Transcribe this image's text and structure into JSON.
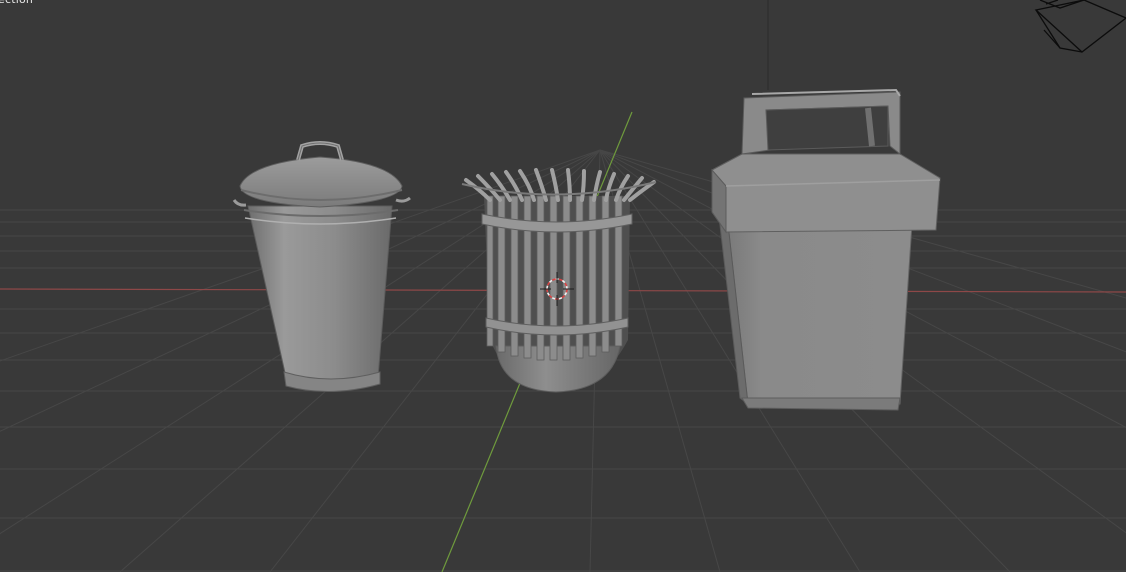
{
  "viewport": {
    "collection_label": "ection",
    "background_color": "#393939",
    "grid_color": "#4a4a4a",
    "x_axis_color": "#9a4c4c",
    "y_axis_color": "#6d9a3c"
  },
  "objects": [
    {
      "name": "metal-trash-can-with-lid",
      "color": "#8a8a8a"
    },
    {
      "name": "slatted-basket-trash-bin",
      "color": "#8a8a8a"
    },
    {
      "name": "square-trash-bin-with-handle",
      "color": "#8a8a8a"
    }
  ],
  "scene": {
    "camera_gizmo": "camera-icon",
    "origin_marker": "3d-cursor-icon"
  }
}
